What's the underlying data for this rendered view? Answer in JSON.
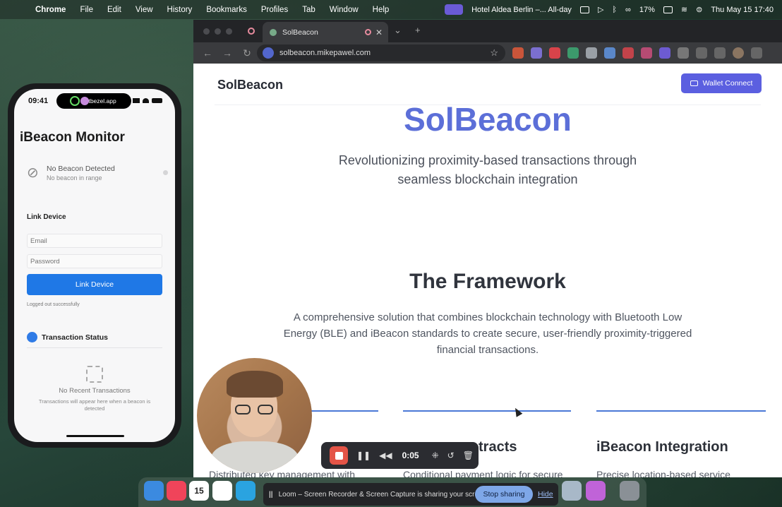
{
  "menubar": {
    "app": "Chrome",
    "items": [
      "File",
      "Edit",
      "View",
      "History",
      "Bookmarks",
      "Profiles",
      "Tab",
      "Window",
      "Help"
    ],
    "event": "Hotel Aldea Berlin –... All-day",
    "battery": "17%",
    "datetime": "Thu May 15  17:40"
  },
  "browser": {
    "tab_title": "SolBeacon",
    "url": "solbeacon.mikepawel.com"
  },
  "page": {
    "logo": "SolBeacon",
    "wallet_button": "Wallet Connect",
    "hero_title": "SolBeacon",
    "hero_subtitle": "Revolutionizing proximity-based transactions through seamless blockchain integration",
    "framework_title": "The Framework",
    "framework_text": "A comprehensive solution that combines blockchain technology with Bluetooth Low Energy (BLE) and iBeacon standards to create secure, user-friendly proximity-triggered financial transactions.",
    "cards": [
      {
        "title": "",
        "text": "Distributed key management with"
      },
      {
        "title": "tracts",
        "text": "Conditional payment logic for secure"
      },
      {
        "title": "iBeacon Integration",
        "text": "Precise location-based service"
      }
    ],
    "accent": "#5c6fd8"
  },
  "phone": {
    "time": "09:41",
    "island_label": "getbezel.app",
    "app_title": "iBeacon Monitor",
    "beacon_status": "No Beacon Detected",
    "beacon_sub": "No beacon in range",
    "link_heading": "Link Device",
    "email_placeholder": "Email",
    "password_placeholder": "Password",
    "link_button": "Link Device",
    "logged_out_msg": "Logged out successfully",
    "tx_heading": "Transaction Status",
    "tx_empty": "No Recent Transactions",
    "tx_desc": "Transactions will appear here when a beacon is detected"
  },
  "recorder": {
    "time": "0:05"
  },
  "sharing": {
    "message": "Loom – Screen Recorder & Screen Capture is sharing your screen.",
    "stop_label": "Stop sharing",
    "hide_label": "Hide"
  },
  "dock": {
    "calendar_day": "15"
  }
}
